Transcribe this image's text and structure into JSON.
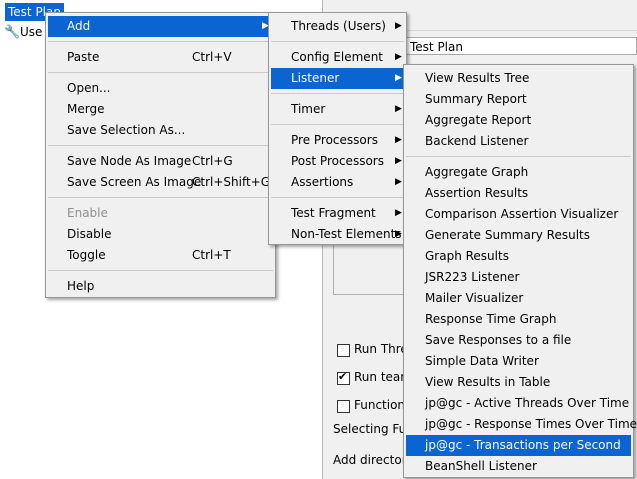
{
  "tree": {
    "root": "Test Plan",
    "child": "Use"
  },
  "right_panel": {
    "name_value": "Test Plan",
    "run_threads": "Run Thre",
    "run_teardown": "Run tearl",
    "functional": "Function",
    "selecting": "Selecting Fu",
    "add_directory": "Add directory"
  },
  "context_menu": {
    "add": "Add",
    "paste": "Paste",
    "paste_shortcut": "Ctrl+V",
    "open": "Open...",
    "merge": "Merge",
    "save_selection": "Save Selection As...",
    "save_node_image": "Save Node As Image",
    "save_node_image_shortcut": "Ctrl+G",
    "save_screen_image": "Save Screen As Image",
    "save_screen_image_shortcut": "Ctrl+Shift+G",
    "enable": "Enable",
    "disable": "Disable",
    "toggle": "Toggle",
    "toggle_shortcut": "Ctrl+T",
    "help": "Help"
  },
  "add_menu": {
    "threads": "Threads (Users)",
    "config_element": "Config Element",
    "listener": "Listener",
    "timer": "Timer",
    "pre_processors": "Pre Processors",
    "post_processors": "Post Processors",
    "assertions": "Assertions",
    "test_fragment": "Test Fragment",
    "non_test_elements": "Non-Test Elements"
  },
  "listener_menu": {
    "items": [
      "View Results Tree",
      "Summary Report",
      "Aggregate Report",
      "Backend Listener",
      "Aggregate Graph",
      "Assertion Results",
      "Comparison Assertion Visualizer",
      "Generate Summary Results",
      "Graph Results",
      "JSR223 Listener",
      "Mailer Visualizer",
      "Response Time Graph",
      "Save Responses to a file",
      "Simple Data Writer",
      "View Results in Table",
      "jp@gc - Active Threads Over Time",
      "jp@gc - Response Times Over Time",
      "jp@gc - Transactions per Second",
      "BeanShell Listener"
    ],
    "selected": "jp@gc - Transactions per Second"
  },
  "colors": {
    "selection": "#0a64d2",
    "menu_bg": "#f0f0f0",
    "panel_bg": "#f0f0f0"
  },
  "icons": {
    "submenu": "chevron-right-icon",
    "tree_item": "wrench-icon",
    "checkbox": "checkbox"
  }
}
